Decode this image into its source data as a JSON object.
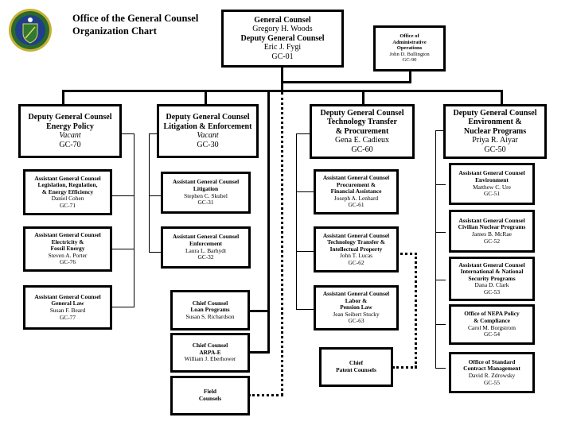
{
  "header": {
    "title_line1": "Office of the General Counsel",
    "title_line2": "Organization Chart",
    "seal_icon": "department-of-energy-seal",
    "seal_colors": {
      "ring": "#c9b037",
      "inner": "#1f3f8a",
      "shield": "#2f7a2f"
    }
  },
  "top": {
    "gc": {
      "title": "General Counsel",
      "name": "Gregory H. Woods",
      "deputy_title": "Deputy General Counsel",
      "deputy_name": "Eric J. Fygi",
      "code": "GC-01"
    },
    "admin": {
      "line1": "Office of",
      "line2": "Administrative",
      "line3": "Operations",
      "name": "John D. Bullington",
      "code": "GC-90"
    }
  },
  "deputies": [
    {
      "title": "Deputy General Counsel",
      "area1": "Energy Policy",
      "area2": "",
      "name": "Vacant",
      "code": "GC-70"
    },
    {
      "title": "Deputy General Counsel",
      "area1": "Litigation & Enforcement",
      "area2": "",
      "name": "Vacant",
      "code": "GC-30"
    },
    {
      "title": "Deputy General Counsel",
      "area1": "Technology Transfer",
      "area2": "& Procurement",
      "name": "Gena E. Cadieux",
      "code": "GC-60"
    },
    {
      "title": "Deputy General Counsel",
      "area1": "Environment &",
      "area2": "Nuclear Programs",
      "name": "Priya R. Aiyar",
      "code": "GC-50"
    }
  ],
  "energy_policy": [
    {
      "title": "Assistant General Counsel",
      "area1": "Legislation, Regulation,",
      "area2": "& Energy Efficiency",
      "name": "Daniel Cohen",
      "code": "GC-71"
    },
    {
      "title": "Assistant General Counsel",
      "area1": "Electricity &",
      "area2": "Fossil Energy",
      "name": "Steven A. Porter",
      "code": "GC-76"
    },
    {
      "title": "Assistant General Counsel",
      "area1": "General Law",
      "area2": "",
      "name": "Susan F. Beard",
      "code": "GC-77"
    }
  ],
  "litigation": [
    {
      "title": "Assistant General Counsel",
      "area1": "Litigation",
      "name": "Stephen C. Skubel",
      "code": "GC-31"
    },
    {
      "title": "Assistant General Counsel",
      "area1": "Enforcement",
      "name": "Laura L. Barhydt",
      "code": "GC-32"
    }
  ],
  "chief_counsels": [
    {
      "title": "Chief Counsel",
      "area": "Loan Programs",
      "name": "Susan S. Richardson"
    },
    {
      "title": "Chief Counsel",
      "area": "ARPA-E",
      "name": "William J. Eberhower"
    }
  ],
  "field": {
    "line1": "Field",
    "line2": "Counsels"
  },
  "tech_transfer": [
    {
      "title": "Assistant General Counsel",
      "area1": "Procurement &",
      "area2": "Financial Assistance",
      "name": "Joseph A. Lenhard",
      "code": "GC-61"
    },
    {
      "title": "Assistant General Counsel",
      "area1": "Technology Transfer &",
      "area2": "Intellectual Property",
      "name": "John T. Lucas",
      "code": "GC-62"
    },
    {
      "title": "Assistant General Counsel",
      "area1": "Labor &",
      "area2": "Pension Law",
      "name": "Jean Seibert Stucky",
      "code": "GC-63"
    }
  ],
  "patent": {
    "line1": "Chief",
    "line2": "Patent Counsels"
  },
  "environment": [
    {
      "title": "Assistant General Counsel",
      "area1": "Environment",
      "area2": "",
      "name": "Matthew C. Ure",
      "code": "GC-51"
    },
    {
      "title": "Assistant General Counsel",
      "area1": "Civilian Nuclear Programs",
      "area2": "",
      "name": "James B. McRae",
      "code": "GC-52"
    },
    {
      "title": "Assistant General Counsel",
      "area1": "International & National",
      "area2": "Security Programs",
      "name": "Dana D. Clark",
      "code": "GC-53"
    },
    {
      "title": "Office of NEPA Policy",
      "area1": "& Compliance",
      "area2": "",
      "name": "Carol M. Borgstrom",
      "code": "GC-54"
    },
    {
      "title": "Office of Standard",
      "area1": "Contract Management",
      "area2": "",
      "name": "David R. Zdrowsky",
      "code": "GC-55"
    }
  ]
}
